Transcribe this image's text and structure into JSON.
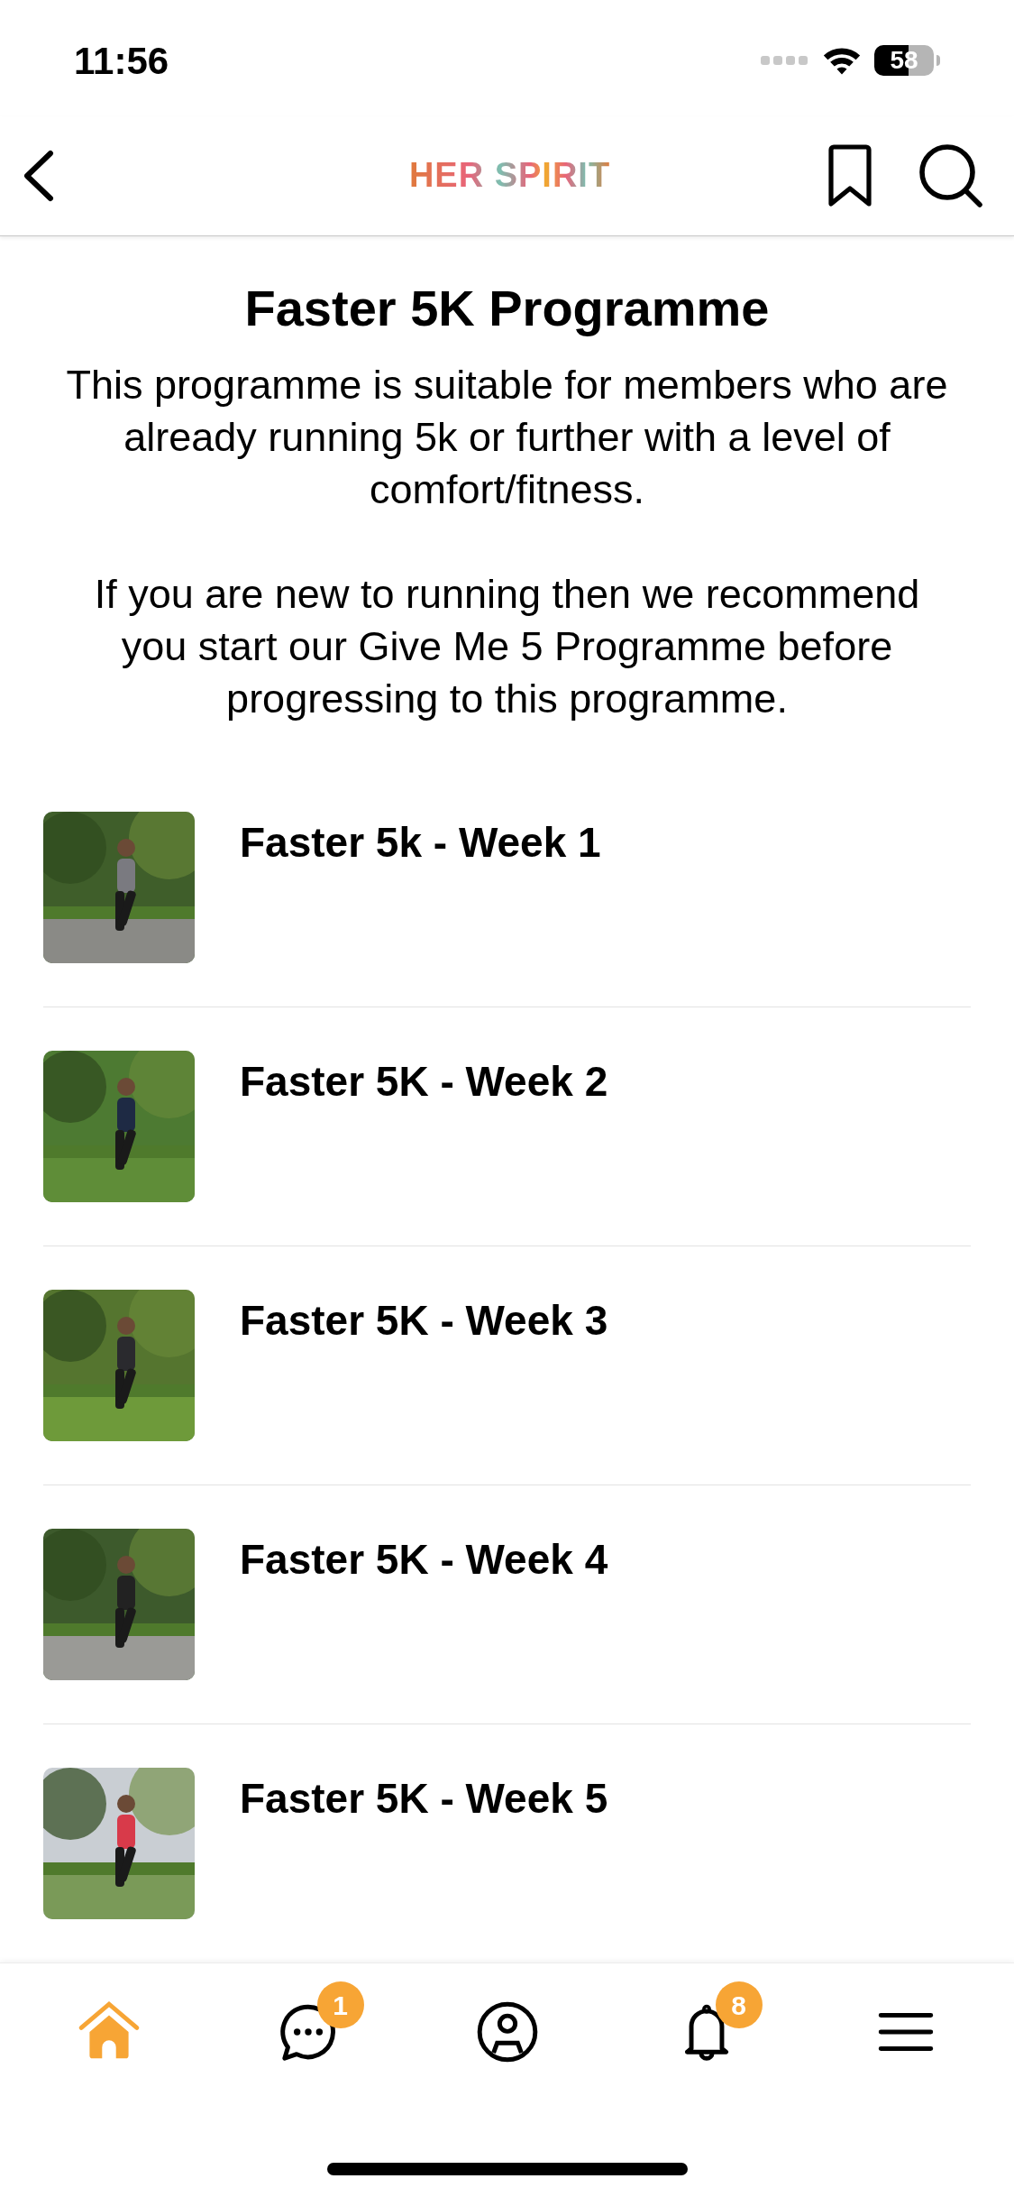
{
  "status_bar": {
    "time": "11:56",
    "battery": "58"
  },
  "header": {
    "logo": "HER SPIRIT"
  },
  "title": "Faster 5K Programme",
  "paragraphs": [
    "This programme is suitable for members who are already running 5k or further with a level of comfort/fitness.",
    "If you are new to running then we recommend you start our Give Me 5 Programme before progressing to this programme."
  ],
  "items": [
    {
      "title": "Faster 5k - Week 1",
      "kind": "picture"
    },
    {
      "title": "Faster 5K - Week 2",
      "kind": "picture"
    },
    {
      "title": "Faster 5K - Week 3",
      "kind": "picture"
    },
    {
      "title": "Faster 5K - Week 4",
      "kind": "picture"
    },
    {
      "title": "Faster 5K - Week 5",
      "kind": "picture"
    }
  ],
  "tab_bar": [
    {
      "kind": "home",
      "selected": true
    },
    {
      "kind": "chat",
      "selected": false,
      "badge": "1"
    },
    {
      "kind": "profile",
      "selected": false
    },
    {
      "kind": "bell",
      "selected": false,
      "badge": "8"
    },
    {
      "kind": "menu",
      "selected": false
    }
  ]
}
